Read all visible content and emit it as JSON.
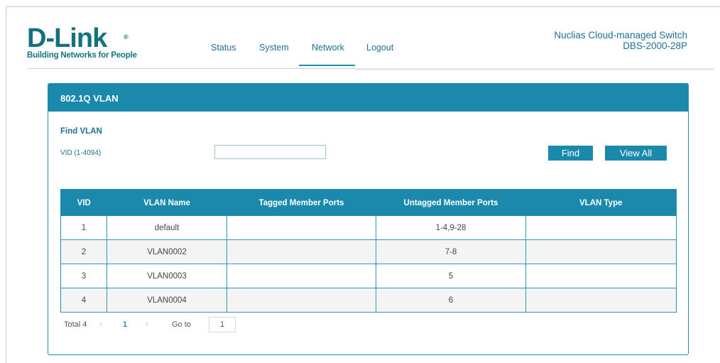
{
  "brand": {
    "logo_text": "D-Link",
    "registered_mark": "®",
    "tagline": "Building Networks for People"
  },
  "nav": {
    "items": [
      "Status",
      "System",
      "Network",
      "Logout"
    ],
    "active": "Network"
  },
  "device": {
    "model_line1": "Nuclias Cloud-managed Switch",
    "model_line2": "DBS-2000-28P"
  },
  "panel": {
    "title": "802.1Q VLAN",
    "find_title": "Find VLAN",
    "vid_label": "VID (1-4094)",
    "vid_value": "",
    "find_label": "Find",
    "view_all_label": "View All"
  },
  "table": {
    "columns": [
      "VID",
      "VLAN Name",
      "Tagged Member Ports",
      "Untagged Member Ports",
      "VLAN Type"
    ],
    "rows": [
      [
        "1",
        "default",
        "",
        "1-4,9-28",
        ""
      ],
      [
        "2",
        "VLAN0002",
        "",
        "7-8",
        ""
      ],
      [
        "3",
        "VLAN0003",
        "",
        "5",
        ""
      ],
      [
        "4",
        "VLAN0004",
        "",
        "6",
        ""
      ]
    ]
  },
  "pagination": {
    "total_label": "Total 4",
    "prev_icon": "‹",
    "current_page": "1",
    "next_icon": "›",
    "goto_label": "Go to",
    "goto_value": "1"
  },
  "colors": {
    "accent": "#1b89ab",
    "brand": "#12737f",
    "link": "#1f6f93"
  }
}
